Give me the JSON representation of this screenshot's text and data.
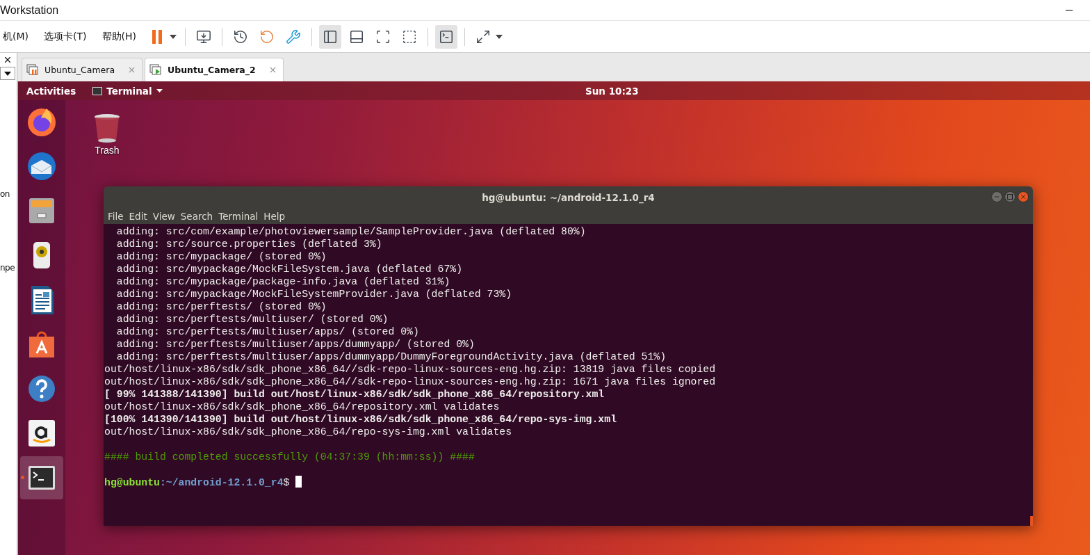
{
  "app": {
    "title": "Workstation"
  },
  "menus": [
    "机(M)",
    "选项卡(T)",
    "帮助(H)"
  ],
  "toolbar": [
    {
      "kind": "pause",
      "pressed": false
    },
    {
      "kind": "caret",
      "pressed": false
    },
    {
      "kind": "sep"
    },
    {
      "kind": "send-keys",
      "pressed": false
    },
    {
      "kind": "sep"
    },
    {
      "kind": "snapshot",
      "pressed": false
    },
    {
      "kind": "revert",
      "pressed": false
    },
    {
      "kind": "manage",
      "pressed": false
    },
    {
      "kind": "sep"
    },
    {
      "kind": "library",
      "pressed": true
    },
    {
      "kind": "thumbs",
      "pressed": false
    },
    {
      "kind": "fullscreen",
      "pressed": false
    },
    {
      "kind": "unity",
      "pressed": false
    },
    {
      "kind": "sep"
    },
    {
      "kind": "console",
      "pressed": true
    },
    {
      "kind": "sep"
    },
    {
      "kind": "stretch",
      "pressed": false
    },
    {
      "kind": "caret",
      "pressed": false
    }
  ],
  "left_panel": {
    "texts": [
      "on",
      "npe"
    ]
  },
  "tabs": [
    {
      "label": "Ubuntu_Camera",
      "selected": false
    },
    {
      "label": "Ubuntu_Camera_2",
      "selected": true
    }
  ],
  "ubuntu": {
    "top_bar": {
      "activities": "Activities",
      "app_menu": "Terminal",
      "clock": "Sun 10:23"
    },
    "dock": [
      {
        "kind": "firefox",
        "running": false
      },
      {
        "kind": "mail",
        "running": false
      },
      {
        "kind": "files",
        "running": false
      },
      {
        "kind": "speaker",
        "running": false
      },
      {
        "kind": "writer",
        "running": false
      },
      {
        "kind": "store",
        "running": false
      },
      {
        "kind": "help",
        "running": false
      },
      {
        "kind": "amazon",
        "running": false
      },
      {
        "kind": "terminal",
        "running": true
      }
    ],
    "desktop_icons": [
      {
        "label": "Trash"
      }
    ]
  },
  "terminal": {
    "title": "hg@ubuntu: ~/android-12.1.0_r4",
    "menu": [
      "File",
      "Edit",
      "View",
      "Search",
      "Terminal",
      "Help"
    ],
    "lines": [
      {
        "kind": "plain",
        "text": "  adding: src/com/example/photoviewersample/SampleProvider.java (deflated 80%)"
      },
      {
        "kind": "plain",
        "text": "  adding: src/source.properties (deflated 3%)"
      },
      {
        "kind": "plain",
        "text": "  adding: src/mypackage/ (stored 0%)"
      },
      {
        "kind": "plain",
        "text": "  adding: src/mypackage/MockFileSystem.java (deflated 67%)"
      },
      {
        "kind": "plain",
        "text": "  adding: src/mypackage/package-info.java (deflated 31%)"
      },
      {
        "kind": "plain",
        "text": "  adding: src/mypackage/MockFileSystemProvider.java (deflated 73%)"
      },
      {
        "kind": "plain",
        "text": "  adding: src/perftests/ (stored 0%)"
      },
      {
        "kind": "plain",
        "text": "  adding: src/perftests/multiuser/ (stored 0%)"
      },
      {
        "kind": "plain",
        "text": "  adding: src/perftests/multiuser/apps/ (stored 0%)"
      },
      {
        "kind": "plain",
        "text": "  adding: src/perftests/multiuser/apps/dummyapp/ (stored 0%)"
      },
      {
        "kind": "plain",
        "text": "  adding: src/perftests/multiuser/apps/dummyapp/DummyForegroundActivity.java (deflated 51%)"
      },
      {
        "kind": "plain",
        "text": "out/host/linux-x86/sdk/sdk_phone_x86_64//sdk-repo-linux-sources-eng.hg.zip: 13819 java files copied"
      },
      {
        "kind": "plain",
        "text": "out/host/linux-x86/sdk/sdk_phone_x86_64//sdk-repo-linux-sources-eng.hg.zip: 1671 java files ignored"
      },
      {
        "kind": "bold",
        "text": "[ 99% 141388/141390] build out/host/linux-x86/sdk/sdk_phone_x86_64/repository.xml"
      },
      {
        "kind": "plain",
        "text": "out/host/linux-x86/sdk/sdk_phone_x86_64/repository.xml validates"
      },
      {
        "kind": "bold",
        "text": "[100% 141390/141390] build out/host/linux-x86/sdk/sdk_phone_x86_64/repo-sys-img.xml"
      },
      {
        "kind": "plain",
        "text": "out/host/linux-x86/sdk/sdk_phone_x86_64/repo-sys-img.xml validates"
      },
      {
        "kind": "blank"
      },
      {
        "kind": "success",
        "text": "#### build completed successfully (04:37:39 (hh:mm:ss)) ####"
      },
      {
        "kind": "blank"
      },
      {
        "kind": "prompt",
        "user": "hg@ubuntu",
        "path": ":~/android-12.1.0_r4",
        "symbol": "$"
      }
    ]
  }
}
